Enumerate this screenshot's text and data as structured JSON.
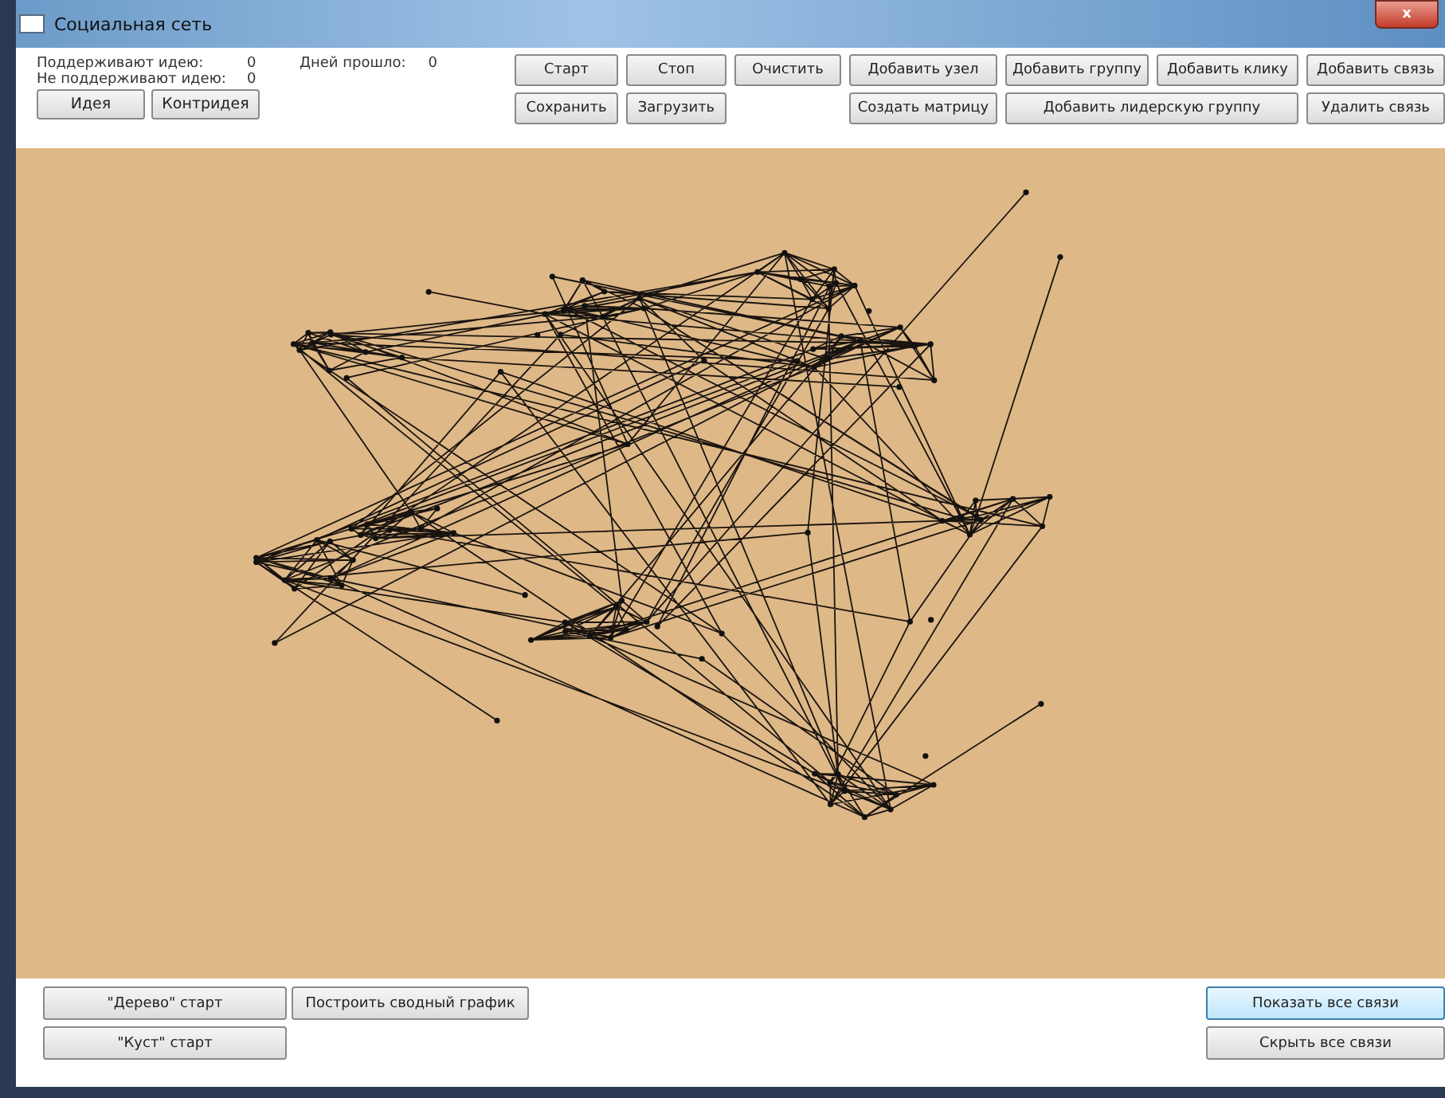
{
  "window": {
    "title": "Социальная сеть",
    "close": "x"
  },
  "stats": [
    {
      "label": "Поддерживают идею:",
      "value": "0"
    },
    {
      "label": "Не поддерживают идею:",
      "value": "0"
    }
  ],
  "days": {
    "label": "Дней прошло:",
    "value": "0"
  },
  "idea_buttons": [
    "Идея",
    "Контридея"
  ],
  "toolbar": [
    "Старт",
    "Стоп",
    "Очистить",
    "Добавить узел",
    "Добавить группу",
    "Добавить клику",
    "Добавить связь",
    "Сохранить",
    "Загрузить",
    "Создать матрицу",
    "Добавить лидерскую группу",
    "Удалить связь"
  ],
  "bottom_left": [
    "\"Дерево\" старт",
    "\"Куст\" старт"
  ],
  "summary_button": "Построить сводный график",
  "bottom_right": [
    {
      "label": "Показать все связи",
      "hovered": true
    },
    {
      "label": "Скрыть все связи",
      "hovered": false
    }
  ]
}
